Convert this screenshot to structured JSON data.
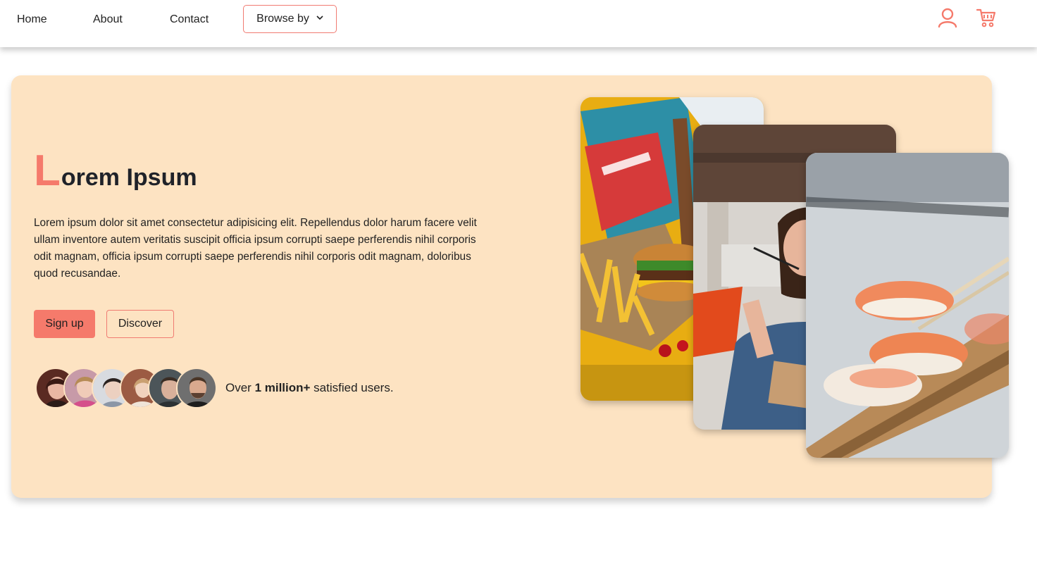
{
  "nav": {
    "home": "Home",
    "about": "About",
    "contact": "Contact",
    "browse": "Browse by"
  },
  "icons": {
    "user": "user-icon",
    "cart": "cart-icon",
    "chevron": "chevron-down-icon"
  },
  "hero": {
    "title_initial": "L",
    "title_rest": "orem Ipsum",
    "description": "Lorem ipsum dolor sit amet consectetur adipisicing elit. Repellendus dolor harum facere velit ullam inventore autem veritatis suscipit officia ipsum corrupti saepe perferendis nihil corporis odit magnam, officia ipsum corrupti saepe perferendis nihil corporis odit magnam, doloribus quod recusandae.",
    "signup_label": "Sign up",
    "discover_label": "Discover",
    "users_prefix": "Over ",
    "users_bold": "1 million+",
    "users_suffix": " satisfied users."
  },
  "colors": {
    "accent": "#f57a6b",
    "hero_bg": "#fde3c2",
    "text": "#1f2229"
  },
  "images": {
    "photo1": "burger and fries with magazine",
    "photo2": "woman eating with chopsticks",
    "photo3": "salmon sushi on wooden board"
  }
}
